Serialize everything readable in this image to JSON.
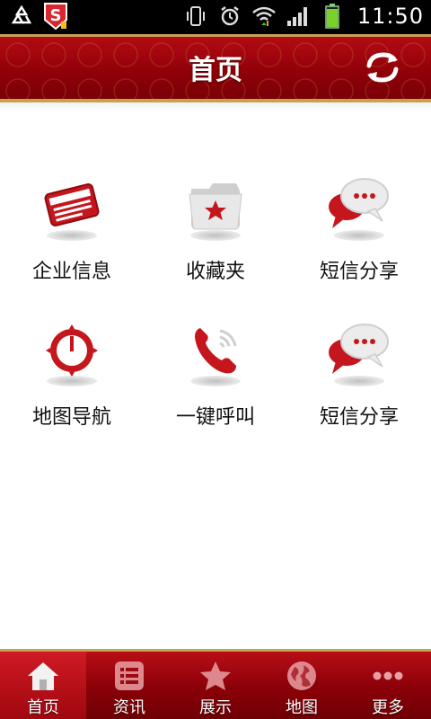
{
  "status_bar": {
    "time": "11:50",
    "left_icons": [
      "recycle-icon",
      "app-s-icon"
    ],
    "right_icons": [
      "vibrate-icon",
      "alarm-icon",
      "wifi-icon",
      "signal-icon",
      "battery-icon"
    ]
  },
  "header": {
    "title": "首页",
    "refresh_icon": "refresh-icon",
    "color": "#9a0a12",
    "border_color": "#c9a24e"
  },
  "grid": {
    "items": [
      {
        "label": "企业信息",
        "icon": "card-icon"
      },
      {
        "label": "收藏夹",
        "icon": "folder-star-icon"
      },
      {
        "label": "短信分享",
        "icon": "sms-icon"
      },
      {
        "label": "地图导航",
        "icon": "compass-icon"
      },
      {
        "label": "一键呼叫",
        "icon": "phone-icon"
      },
      {
        "label": "短信分享",
        "icon": "sms-icon"
      }
    ]
  },
  "tabbar": {
    "active_index": 0,
    "tabs": [
      {
        "label": "首页",
        "icon": "home-icon"
      },
      {
        "label": "资讯",
        "icon": "news-icon"
      },
      {
        "label": "展示",
        "icon": "star-icon"
      },
      {
        "label": "地图",
        "icon": "globe-icon"
      },
      {
        "label": "更多",
        "icon": "more-icon"
      }
    ]
  }
}
